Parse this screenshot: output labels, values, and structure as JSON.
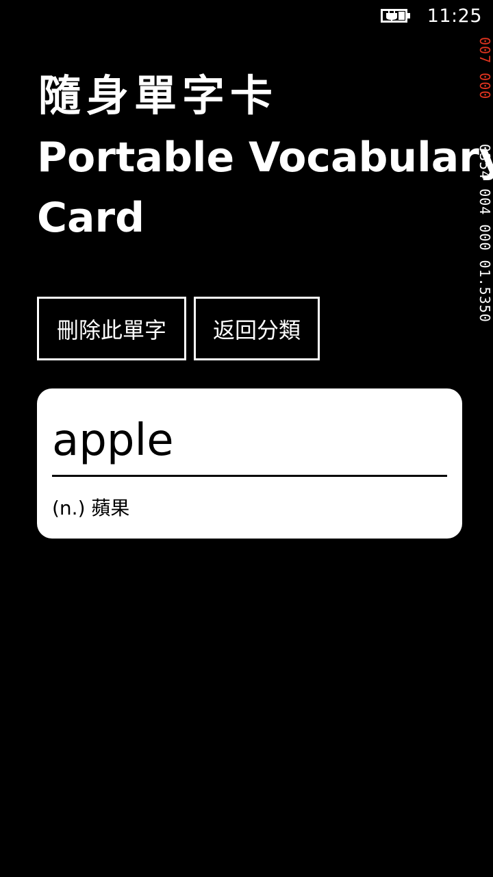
{
  "status_bar": {
    "time": "11:25",
    "battery_icon": "battery-charging-icon"
  },
  "perf_counters": {
    "top": "007 000",
    "bottom": "0354 004 000 01.5350"
  },
  "header": {
    "app_title": "隨身單字卡",
    "page_title_line1": "Portable Vocabulary",
    "page_title_line2": "Card"
  },
  "actions": {
    "delete_label": "刪除此單字",
    "back_label": "返回分類"
  },
  "card": {
    "word": "apple",
    "meaning": "(n.) 蘋果"
  }
}
